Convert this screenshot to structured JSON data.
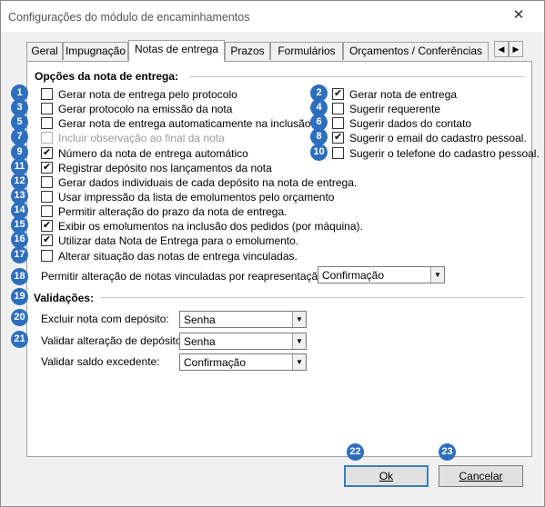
{
  "window": {
    "title": "Configurações do módulo de encaminhamentos",
    "close_glyph": "✕"
  },
  "tabs": [
    {
      "label": "Geral"
    },
    {
      "label": "Impugnação"
    },
    {
      "label": "Notas de entrega",
      "active": true
    },
    {
      "label": "Prazos"
    },
    {
      "label": "Formulários"
    },
    {
      "label": "Orçamentos / Conferências"
    }
  ],
  "tab_scroll": {
    "left": "◀",
    "right": "▶"
  },
  "options_group": {
    "title": "Opções da nota de entrega:",
    "left": [
      {
        "badge": "1",
        "label": "Gerar nota de entrega pelo protocolo",
        "checked": false
      },
      {
        "badge": "3",
        "label": "Gerar protocolo na emissão da nota",
        "checked": false
      },
      {
        "badge": "5",
        "label": "Gerar nota de entrega automaticamente na inclusão",
        "checked": false
      },
      {
        "badge": "7",
        "label": "Incluir observação ao final da nota",
        "checked": false,
        "disabled": true
      },
      {
        "badge": "9",
        "label": "Número da nota de entrega automático",
        "checked": true
      },
      {
        "badge": "11",
        "label": "Registrar depósito nos lançamentos da nota",
        "checked": true
      },
      {
        "badge": "12",
        "label": "Gerar dados individuais de cada depósito na nota de entrega.",
        "checked": false
      },
      {
        "badge": "13",
        "label": "Usar impressão da lista de emolumentos pelo orçamento",
        "checked": false
      },
      {
        "badge": "14",
        "label": "Permitir alteração do prazo da nota de entrega.",
        "checked": false
      },
      {
        "badge": "15",
        "label": "Exibir os emolumentos na inclusão dos pedidos (por máquina).",
        "checked": true
      },
      {
        "badge": "16",
        "label": "Utilizar data Nota de Entrega para o emolumento.",
        "checked": true
      },
      {
        "badge": "17",
        "label": "Alterar situação das notas de entrega vinculadas.",
        "checked": false
      }
    ],
    "right": [
      {
        "badge": "2",
        "label": "Gerar nota de entrega",
        "checked": true
      },
      {
        "badge": "4",
        "label": "Sugerir requerente",
        "checked": false
      },
      {
        "badge": "6",
        "label": "Sugerir dados do contato",
        "checked": false
      },
      {
        "badge": "8",
        "label": "Sugerir o email do cadastro pessoal.",
        "checked": true
      },
      {
        "badge": "10",
        "label": "Sugerir o telefone do cadastro pessoal.",
        "checked": false
      }
    ],
    "reapresentacao": {
      "badge": "18",
      "label": "Permitir alteração de notas vinculadas por reapresentação:",
      "value": "Confirmação"
    }
  },
  "validacoes": {
    "badge": "19",
    "title": "Validações:",
    "rows": [
      {
        "badge": "20",
        "label": "Excluir nota com depósito:",
        "value": "Senha"
      },
      {
        "badge": "21",
        "label": "Validar alteração de depósito:",
        "value": "Senha"
      },
      {
        "badge": "",
        "label": "Validar saldo excedente:",
        "value": "Confirmação"
      }
    ]
  },
  "combo_arrow": "▼",
  "buttons": {
    "ok": {
      "badge": "22",
      "label": "Ok"
    },
    "cancel": {
      "badge": "23",
      "label": "Cancelar"
    }
  },
  "colors": {
    "badge": "#2e6fbd",
    "default_button_border": "#3c7fb1"
  }
}
